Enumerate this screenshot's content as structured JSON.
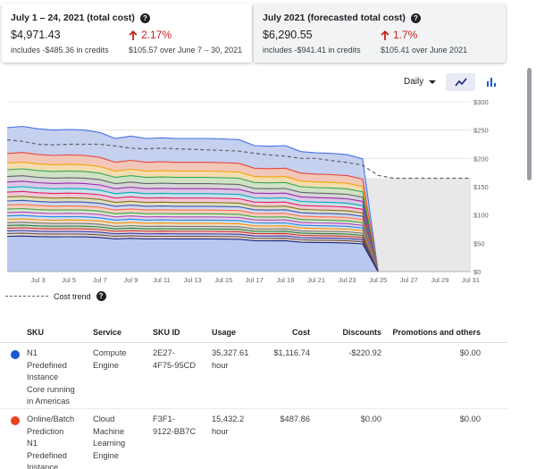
{
  "cards": [
    {
      "title": "July 1 – 24, 2021 (total cost)",
      "amount": "$4,971.43",
      "credits": "includes -$485.36 in credits",
      "change_pct": "2.17%",
      "change_note": "$105.57 over June 7 – 30, 2021",
      "help_icon": "help-icon"
    },
    {
      "title": "July 2021 (forecasted total cost)",
      "amount": "$6,290.55",
      "credits": "includes -$941.41 in credits",
      "change_pct": "1.7%",
      "change_note": "$105.41 over June 2021",
      "help_icon": "help-icon"
    }
  ],
  "controls": {
    "granularity": "Daily",
    "line_chart_icon": "line-chart-icon",
    "bar_chart_icon": "bar-chart-icon"
  },
  "colors": {
    "increase": "#c5221f",
    "toggle_active_bg": "#e8eaf6",
    "forecast_fill": "#e8e8e8",
    "total_line": "#4472e8"
  },
  "chart_data": {
    "type": "area",
    "x_ticks": [
      "Jul 3",
      "Jul 5",
      "Jul 7",
      "Jul 9",
      "Jul 11",
      "Jul 13",
      "Jul 15",
      "Jul 17",
      "Jul 19",
      "Jul 21",
      "Jul 23",
      "Jul 25",
      "Jul 27",
      "Jul 29",
      "Jul 31"
    ],
    "y_ticks": [
      "$0",
      "$50",
      "$100",
      "$150",
      "$200",
      "$250",
      "$300"
    ],
    "ylim": [
      0,
      300
    ],
    "stacked": true,
    "actual_total": {
      "x": [
        1,
        2,
        3,
        4,
        5,
        6,
        7,
        8,
        9,
        10,
        11,
        12,
        13,
        14,
        15,
        16,
        17,
        18,
        19,
        20,
        21,
        22,
        23,
        24
      ],
      "values": [
        240,
        242,
        238,
        236,
        237,
        236,
        232,
        222,
        226,
        222,
        223,
        222,
        222,
        222,
        221,
        220,
        210,
        209,
        210,
        200,
        198,
        197,
        195,
        188
      ]
    },
    "cost_trend": {
      "name": "Cost trend",
      "x": [
        1,
        2,
        3,
        4,
        5,
        6,
        7,
        8,
        9,
        10,
        11,
        12,
        13,
        14,
        15,
        16,
        17,
        18,
        19,
        20,
        21,
        22,
        23,
        24,
        25,
        26,
        27,
        28,
        29,
        30,
        31
      ],
      "values": [
        233,
        230,
        225,
        224,
        225,
        225,
        225,
        222,
        218,
        217,
        218,
        217,
        216,
        215,
        214,
        213,
        209,
        206,
        204,
        200,
        200,
        196,
        193,
        188,
        170,
        165,
        165,
        165,
        165,
        165,
        165
      ]
    },
    "forecast_region": {
      "from_x": 24,
      "to_x": 31
    },
    "bands": [
      {
        "color": "#c6d0ef",
        "share": 0.19
      },
      {
        "color": "#f2c7b8",
        "share": 0.07
      },
      {
        "color": "#f4dcb0",
        "share": 0.05
      },
      {
        "color": "#cfe3c4",
        "share": 0.05
      },
      {
        "color": "#d6d6d6",
        "share": 0.04
      },
      {
        "color": "#dcc8e4",
        "share": 0.04
      },
      {
        "color": "#c8e2e8",
        "share": 0.035
      },
      {
        "color": "#f0c8d8",
        "share": 0.035
      },
      {
        "color": "#e0e0c0",
        "share": 0.03
      },
      {
        "color": "#cdd8f0",
        "share": 0.03
      },
      {
        "color": "#f2d0c0",
        "share": 0.03
      },
      {
        "color": "#d8e8d0",
        "share": 0.025
      },
      {
        "color": "#e8d0e8",
        "share": 0.025
      },
      {
        "color": "#d0e0f0",
        "share": 0.025
      },
      {
        "color": "#f0e0c8",
        "share": 0.025
      },
      {
        "color": "#dcdcdc",
        "share": 0.02
      },
      {
        "color": "#c8d8c8",
        "share": 0.02
      },
      {
        "color": "#f0d0d0",
        "share": 0.02
      },
      {
        "color": "#d0d0f0",
        "share": 0.02
      },
      {
        "color": "#e8e0d0",
        "share": 0.02
      },
      {
        "color": "#b8c8f0",
        "share": 0.26
      }
    ],
    "band_lines": [
      "#4472e8",
      "#e8453c",
      "#f4a300",
      "#34a853",
      "#5f6368",
      "#9c27b0",
      "#00acc1",
      "#e91e63",
      "#827717",
      "#3f51b5",
      "#ff7043",
      "#43a047",
      "#ab47bc",
      "#1e88e5",
      "#fb8c00",
      "#757575",
      "#2e7d32",
      "#d32f2f",
      "#303f9f",
      "#6d4c41",
      "#1a237e"
    ]
  },
  "legend": {
    "cost_trend_label": "Cost trend",
    "cost_trend_icon": "help-icon"
  },
  "table": {
    "headers": [
      "SKU",
      "Service",
      "SKU ID",
      "Usage",
      "Cost",
      "Discounts",
      "Promotions and others"
    ],
    "rows": [
      {
        "dot_color": "#1a56d6",
        "sku": [
          "N1",
          "Predefined",
          "Instance",
          "Core running",
          "in Americas"
        ],
        "service": [
          "Compute",
          "Engine"
        ],
        "sku_id": [
          "2E27-",
          "4F75-95CD"
        ],
        "usage": [
          "35,327.61",
          "hour"
        ],
        "cost": "$1,116.74",
        "discounts": "-$220.92",
        "promotions": "$0.00"
      },
      {
        "dot_color": "#e8431f",
        "sku": [
          "Online/Batch",
          "Prediction",
          "N1",
          "Predefined",
          "Instance"
        ],
        "service": [
          "Cloud",
          "Machine",
          "Learning",
          "Engine"
        ],
        "sku_id": [
          "F3F1-",
          "9122-BB7C"
        ],
        "usage": [
          "15,432.2",
          "hour"
        ],
        "cost": "$487.86",
        "discounts": "$0.00",
        "promotions": "$0.00"
      }
    ]
  }
}
